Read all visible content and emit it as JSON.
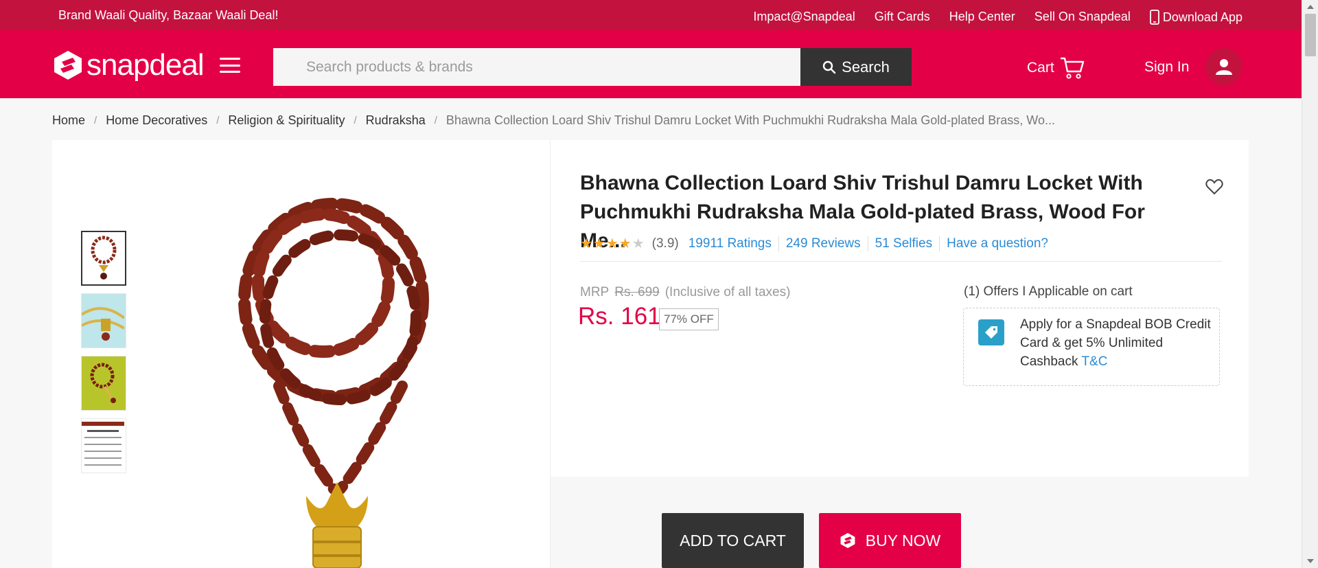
{
  "topbar": {
    "tagline": "Brand Waali Quality, Bazaar Waali Deal!",
    "links": [
      "Impact@Snapdeal",
      "Gift Cards",
      "Help Center",
      "Sell On Snapdeal"
    ],
    "download_app": "Download App"
  },
  "header": {
    "logo_text": "snapdeal",
    "search_placeholder": "Search products & brands",
    "search_button": "Search",
    "cart_label": "Cart",
    "signin_label": "Sign In"
  },
  "breadcrumb": {
    "items": [
      "Home",
      "Home Decoratives",
      "Religion & Spirituality",
      "Rudraksha"
    ],
    "current": "Bhawna Collection Loard Shiv Trishul Damru Locket With Puchmukhi Rudraksha Mala Gold-plated Brass, Wo..."
  },
  "product": {
    "title": "Bhawna Collection Loard Shiv Trishul Damru Locket With Puchmukhi Rudraksha Mala Gold-plated Brass, Wood For Me...",
    "rating_value": 3.9,
    "rating_display": "(3.9)",
    "stars_filled": 4,
    "stars_total": 5,
    "ratings": "19911 Ratings",
    "reviews": "249 Reviews",
    "selfies": "51 Selfies",
    "question": "Have a question?",
    "mrp_label": "MRP",
    "mrp_value": "Rs. 699",
    "tax_note": "(Inclusive of all taxes)",
    "price": "Rs. 161",
    "discount": "77% OFF"
  },
  "offers": {
    "label": "(1) Offers I Applicable on cart",
    "text": "Apply for a Snapdeal BOB Credit Card & get 5% Unlimited Cashback",
    "tc": "T&C"
  },
  "actions": {
    "add_to_cart": "ADD TO CART",
    "buy_now": "BUY NOW"
  },
  "colors": {
    "brand": "#e40046",
    "topbar": "#c4123f",
    "link": "#2a8bd6",
    "star": "#f9a825"
  }
}
